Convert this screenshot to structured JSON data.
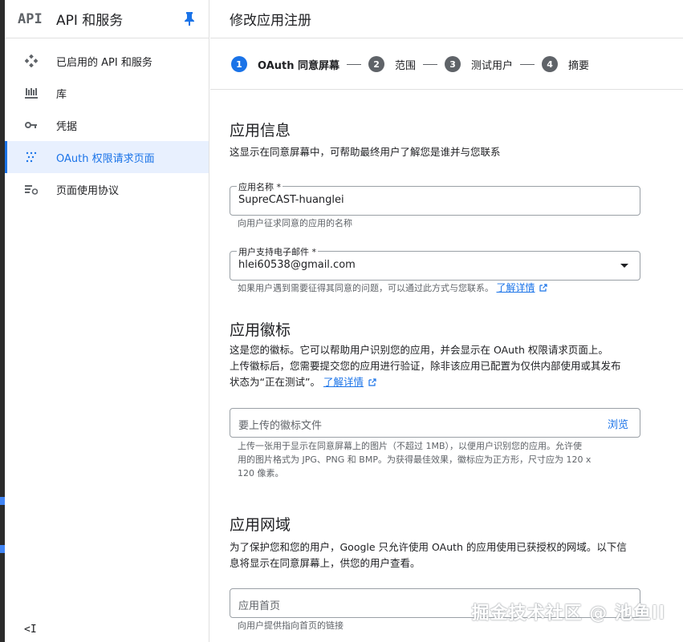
{
  "sidebar": {
    "logo": "API",
    "title": "API 和服务",
    "items": [
      {
        "label": "已启用的 API 和服务",
        "icon": "diamond-nodes-icon"
      },
      {
        "label": "库",
        "icon": "library-icon"
      },
      {
        "label": "凭据",
        "icon": "key-icon"
      },
      {
        "label": "OAuth 权限请求页面",
        "icon": "oauth-dots-icon",
        "active": true
      },
      {
        "label": "页面使用协议",
        "icon": "settings-list-icon"
      }
    ],
    "collapse_label": "<I"
  },
  "header": {
    "title": "修改应用注册"
  },
  "stepper": {
    "steps": [
      {
        "num": "1",
        "label": "OAuth 同意屏幕"
      },
      {
        "num": "2",
        "label": "范围"
      },
      {
        "num": "3",
        "label": "测试用户"
      },
      {
        "num": "4",
        "label": "摘要"
      }
    ]
  },
  "app_info": {
    "heading": "应用信息",
    "desc": "这显示在同意屏幕中，可帮助最终用户了解您是谁并与您联系",
    "app_name": {
      "label": "应用名称 *",
      "value": "SupreCAST-huanglei",
      "hint": "向用户征求同意的应用的名称"
    },
    "support_email": {
      "label": "用户支持电子邮件 *",
      "value": "hlei60538@gmail.com",
      "hint": "如果用户遇到需要征得其同意的问题，可以通过此方式与您联系。",
      "link": "了解详情"
    }
  },
  "app_logo": {
    "heading": "应用徽标",
    "desc_line1": "这是您的徽标。它可以帮助用户识别您的应用，并会显示在 OAuth 权限请求页面上。",
    "desc_line2": "上传徽标后，您需要提交您的应用进行验证，除非该应用已配置为仅供内部使用或其发布",
    "desc_line3": "状态为“正在测试”。",
    "link": "了解详情",
    "file_placeholder": "要上传的徽标文件",
    "browse": "浏览",
    "hint_line1": "上传一张用于显示在同意屏幕上的图片（不超过 1MB），以便用户识别您的应用。允许使",
    "hint_line2": "用的图片格式为 JPG、PNG 和 BMP。为获得最佳效果，徽标应为正方形，尺寸应为 120 x",
    "hint_line3": "120 像素。"
  },
  "app_domain": {
    "heading": "应用网域",
    "desc_line1": "为了保护您和您的用户，Google 只允许使用 OAuth 的应用使用已获授权的网域。以下信",
    "desc_line2": "息将显示在同意屏幕上，供您的用户查看。",
    "home_placeholder": "应用首页",
    "home_hint": "向用户提供指向首页的链接"
  },
  "watermark": "掘金技术社区 @ 池鱼ll",
  "colors": {
    "accent": "#1a73e8",
    "active_bg": "#e8f0fe",
    "step_inactive": "#5f6368"
  }
}
